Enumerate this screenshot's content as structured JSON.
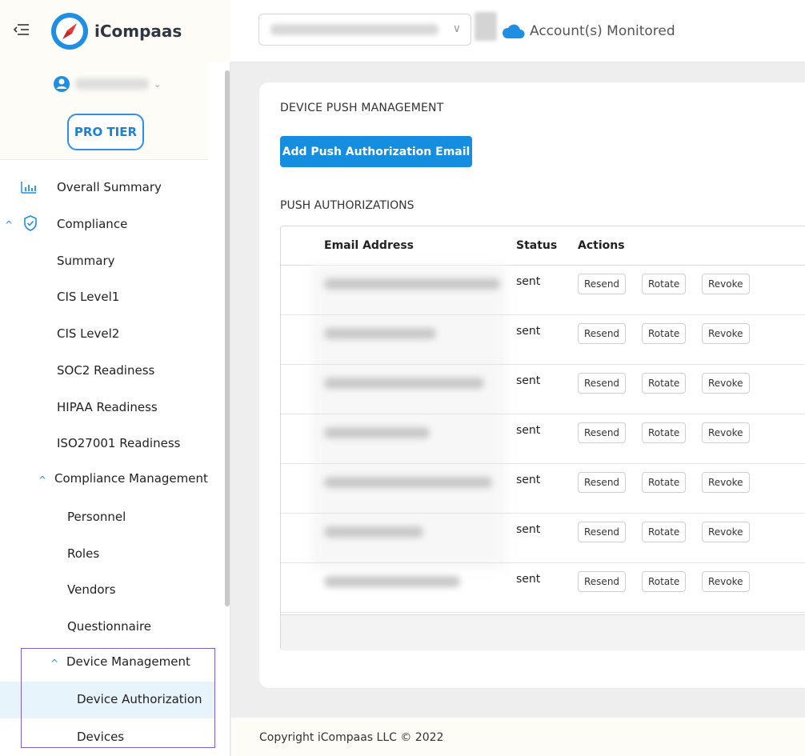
{
  "brand": {
    "name": "iCompaas"
  },
  "header": {
    "account_select_chevron": "∨",
    "monitored_label": "Account(s) Monitored"
  },
  "sidebar": {
    "user_caret": "⌄",
    "tier_label": "PRO TIER",
    "items": {
      "overall_summary": "Overall Summary",
      "compliance": "Compliance",
      "summary": "Summary",
      "cis_level1": "CIS Level1",
      "cis_level2": "CIS Level2",
      "soc2": "SOC2 Readiness",
      "hipaa": "HIPAA Readiness",
      "iso27001": "ISO27001 Readiness",
      "compliance_management": "Compliance Management",
      "personnel": "Personnel",
      "roles": "Roles",
      "vendors": "Vendors",
      "questionnaire": "Questionnaire",
      "device_management": "Device Management",
      "device_authorization": "Device Authorization",
      "devices": "Devices"
    },
    "expanded_caret": "^"
  },
  "main": {
    "title": "DEVICE PUSH MANAGEMENT",
    "add_button": "Add Push Authorization Email",
    "section_title": "PUSH AUTHORIZATIONS",
    "table": {
      "headers": {
        "email": "Email Address",
        "status": "Status",
        "actions": "Actions"
      },
      "rows": [
        {
          "status": "sent",
          "resend": "Resend",
          "rotate": "Rotate",
          "revoke": "Revoke"
        },
        {
          "status": "sent",
          "resend": "Resend",
          "rotate": "Rotate",
          "revoke": "Revoke"
        },
        {
          "status": "sent",
          "resend": "Resend",
          "rotate": "Rotate",
          "revoke": "Revoke"
        },
        {
          "status": "sent",
          "resend": "Resend",
          "rotate": "Rotate",
          "revoke": "Revoke"
        },
        {
          "status": "sent",
          "resend": "Resend",
          "rotate": "Rotate",
          "revoke": "Revoke"
        },
        {
          "status": "sent",
          "resend": "Resend",
          "rotate": "Rotate",
          "revoke": "Revoke"
        },
        {
          "status": "sent",
          "resend": "Resend",
          "rotate": "Rotate",
          "revoke": "Revoke"
        }
      ]
    }
  },
  "footer": {
    "copyright": "Copyright iCompaas LLC © 2022"
  },
  "colors": {
    "accent": "#168ee0",
    "selection_outline": "#7a5fd6",
    "active_row": "#e8f4fc"
  }
}
